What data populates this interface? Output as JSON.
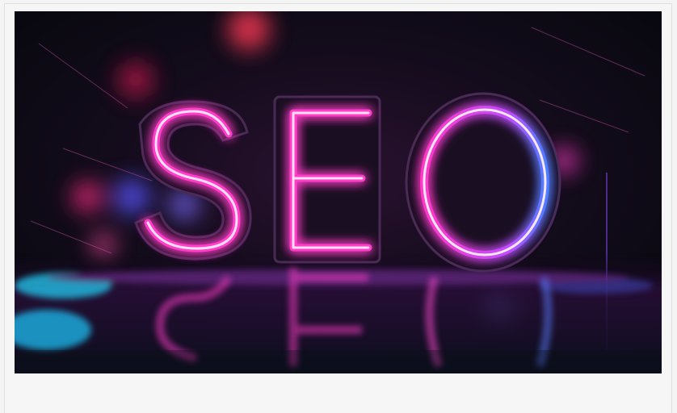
{
  "image": {
    "headline_text": "SEO",
    "colors": {
      "background_dark": "#0a0d14",
      "neon_pink": "#ff3cc8",
      "neon_magenta": "#e21fa8",
      "neon_blue": "#4f7dff",
      "neon_cyan": "#2ee6ff",
      "frame_bg": "#f6f6f6"
    }
  }
}
